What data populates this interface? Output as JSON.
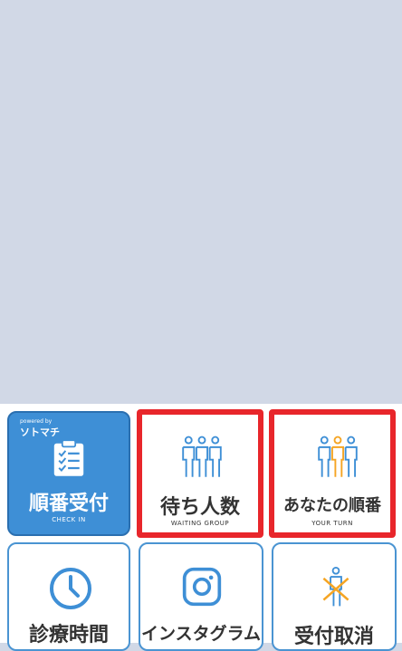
{
  "tiles": [
    {
      "id": "checkin",
      "brand_small": "powered by",
      "brand": "ソトマチ",
      "label": "順番受付",
      "sub": "CHECK IN",
      "icon": "clipboard-checklist-icon"
    },
    {
      "id": "waiting",
      "label": "待ち人数",
      "sub": "WAITING GROUP",
      "icon": "people-group-icon"
    },
    {
      "id": "yourturn",
      "label": "あなたの順番",
      "sub": "YOUR TURN",
      "icon": "people-highlight-icon"
    },
    {
      "id": "hours",
      "label": "診療時間",
      "icon": "clock-icon"
    },
    {
      "id": "instagram",
      "label": "インスタグラム",
      "icon": "instagram-icon"
    },
    {
      "id": "cancel",
      "label": "受付取消",
      "icon": "person-cancel-icon"
    }
  ],
  "colors": {
    "blue": "#3e8fd6",
    "orange": "#f5a524",
    "red": "#e8262b",
    "background": "#d1d8e6"
  }
}
